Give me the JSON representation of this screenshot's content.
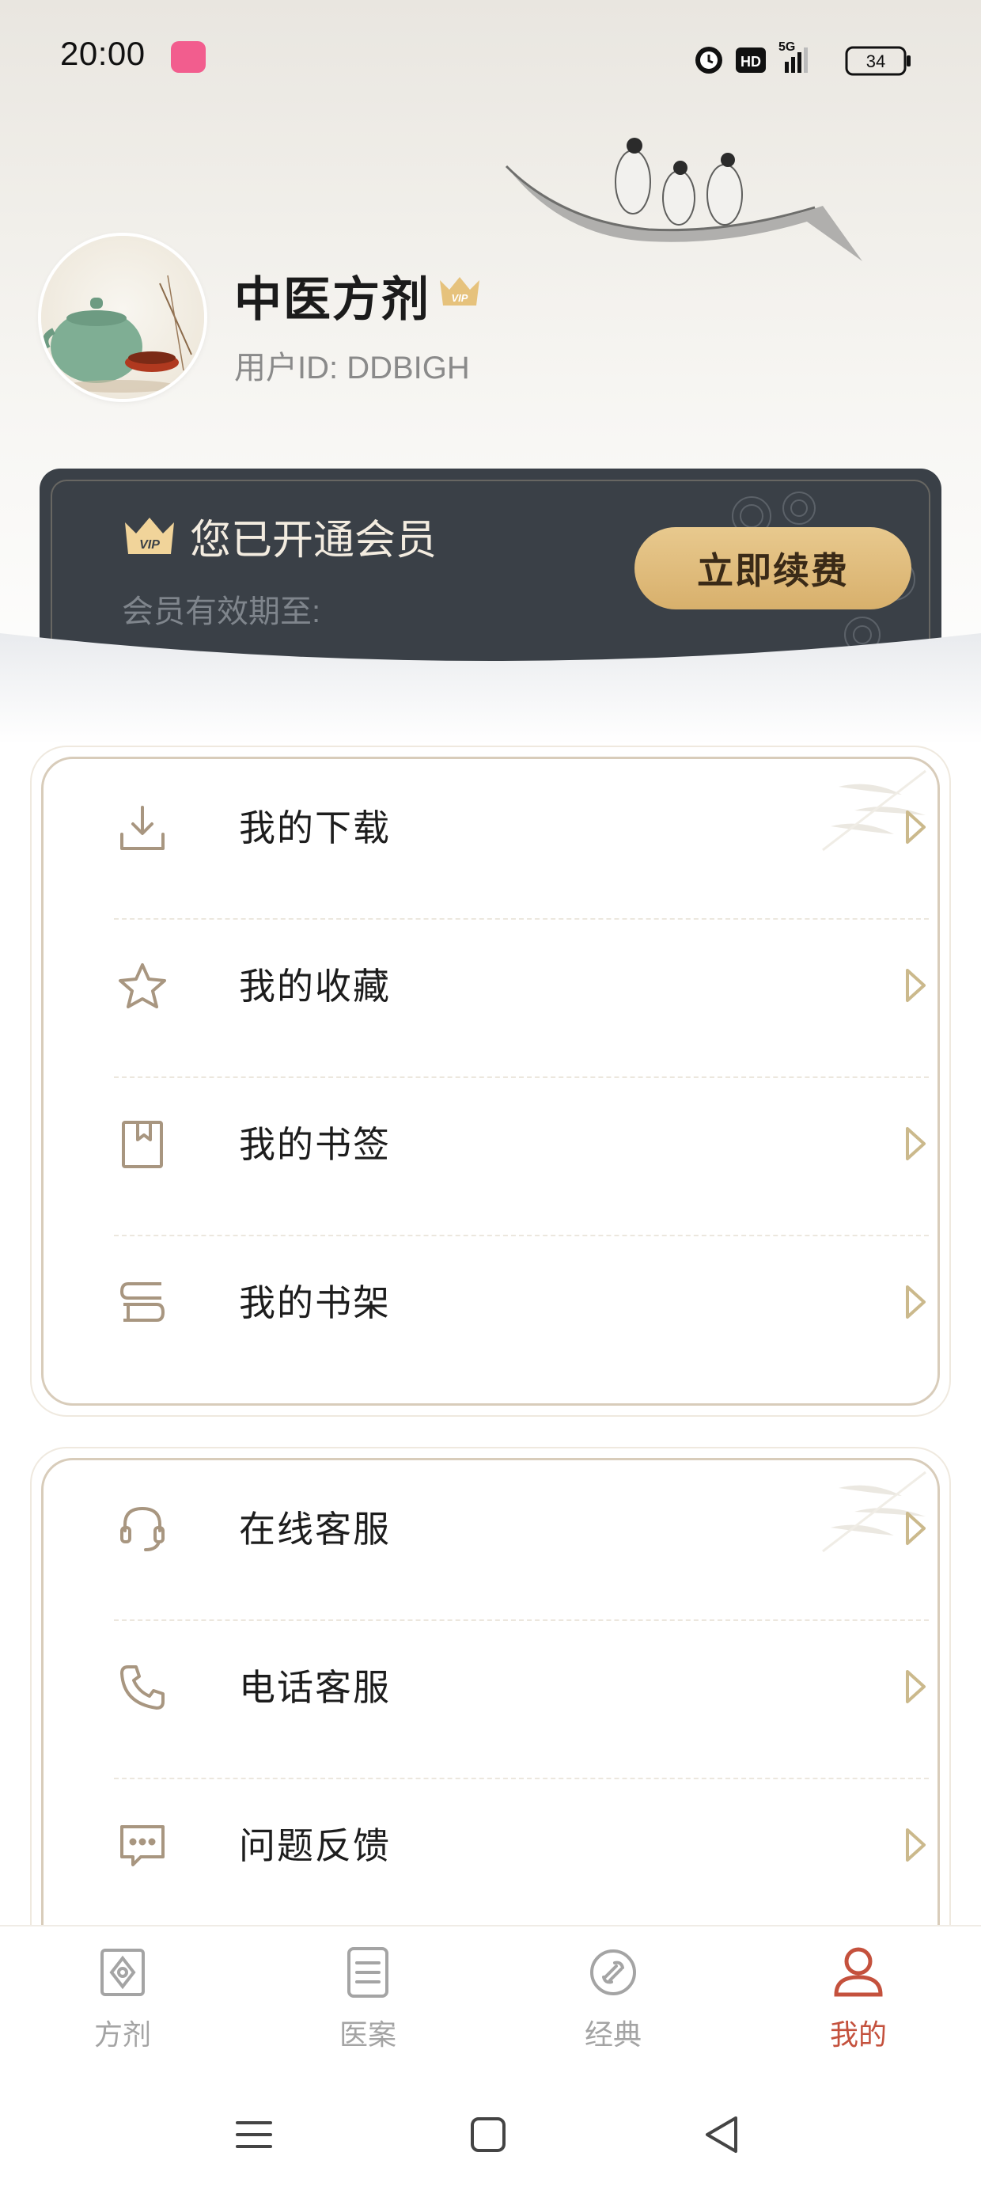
{
  "status_bar": {
    "time": "20:00",
    "network": "5G",
    "hd_label": "HD",
    "battery": "34"
  },
  "profile": {
    "name": "中医方剂",
    "user_id": "用户ID: DDBIGH",
    "vip_badge_text": "VIP"
  },
  "membership": {
    "title": "您已开通会员",
    "expiry_label": "会员有效期至:",
    "renew_button": "立即续费",
    "icon_text": "VIP"
  },
  "menu_group_1": [
    {
      "label": "我的下载",
      "icon": "download-icon"
    },
    {
      "label": "我的收藏",
      "icon": "star-icon"
    },
    {
      "label": "我的书签",
      "icon": "bookmark-icon"
    },
    {
      "label": "我的书架",
      "icon": "bookshelf-icon"
    }
  ],
  "menu_group_2": [
    {
      "label": "在线客服",
      "icon": "headset-icon"
    },
    {
      "label": "电话客服",
      "icon": "phone-icon"
    },
    {
      "label": "问题反馈",
      "icon": "feedback-icon"
    }
  ],
  "tabs": [
    {
      "label": "方剂",
      "icon": "prescription-icon",
      "active": false
    },
    {
      "label": "医案",
      "icon": "document-icon",
      "active": false
    },
    {
      "label": "经典",
      "icon": "classics-icon",
      "active": false
    },
    {
      "label": "我的",
      "icon": "person-icon",
      "active": true
    }
  ],
  "colors": {
    "accent": "#c4513d",
    "card_dark": "#3a4047",
    "gold": "#d8b06c",
    "icon_brown": "#a89680"
  }
}
